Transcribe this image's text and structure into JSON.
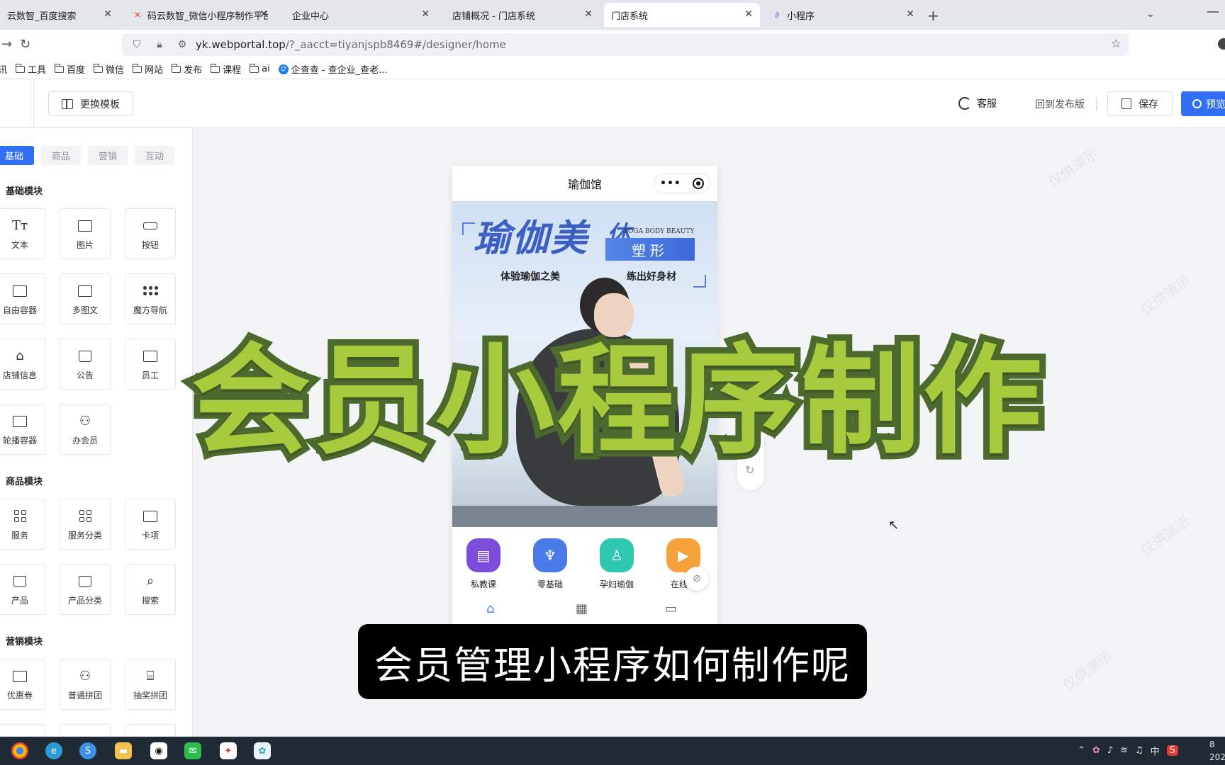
{
  "browser": {
    "tabs": [
      {
        "title": "云数智_百度搜索",
        "icon": "baidu-icon",
        "active": false
      },
      {
        "title": "码云数智_微信小程序制作平台_",
        "icon": "mayun-logo-icon",
        "active": false
      },
      {
        "title": "企业中心",
        "icon": "page-icon",
        "active": false
      },
      {
        "title": "店铺概况 - 门店系统",
        "icon": "page-icon",
        "active": false
      },
      {
        "title": "门店系统",
        "icon": "page-icon",
        "active": true
      },
      {
        "title": "小程序",
        "icon": "miniprogram-icon",
        "active": false
      }
    ],
    "url_domain": "yk.webportal.top",
    "url_path": "/?_aacct=tiyanjspb8469#/designer/home",
    "bookmarks": [
      "资讯",
      "工具",
      "百度",
      "微信",
      "网站",
      "发布",
      "课程",
      "ai",
      "企查查 - 查企业_查老..."
    ]
  },
  "header": {
    "change_template": "更换模板",
    "support": "客服",
    "back_to_published": "回到发布版",
    "save": "保存",
    "preview": "预览"
  },
  "left_panel": {
    "category_tabs": [
      "基础",
      "商品",
      "营销",
      "互动"
    ],
    "active_tab": "基础",
    "sections": {
      "basic": {
        "title": "基础模块",
        "items": [
          "文本",
          "图片",
          "按钮",
          "自由容器",
          "多图文",
          "魔方导航",
          "店铺信息",
          "公告",
          "员工",
          "轮播容器",
          "办会员"
        ]
      },
      "product": {
        "title": "商品模块",
        "items": [
          "服务",
          "服务分类",
          "卡项",
          "产品",
          "产品分类",
          "搜索"
        ]
      },
      "marketing": {
        "title": "营销模块",
        "items": [
          "优惠券",
          "普通拼团",
          "抽奖拼团"
        ]
      }
    }
  },
  "phone": {
    "title": "瑜伽馆",
    "banner": {
      "title_main": "瑜伽美",
      "title_side": "体",
      "title_tag": "塑形",
      "english": "YOGA BODY BEAUTY",
      "sub_left": "体验瑜伽之美",
      "sub_right": "练出好身材"
    },
    "nav_icons": [
      {
        "label": "私教课",
        "color": "#7c4ddb"
      },
      {
        "label": "零基础",
        "color": "#4a7ae8"
      },
      {
        "label": "孕妇瑜伽",
        "color": "#2ec8b0"
      },
      {
        "label": "在线课",
        "color": "#f5a23a"
      }
    ]
  },
  "overlay": {
    "big_title": "会员小程序制作",
    "subtitle": "会员管理小程序如何制作呢"
  },
  "watermark_text": "仅供演示",
  "taskbar": {
    "ime": "中",
    "clock_top": "8",
    "clock_bottom": "202"
  }
}
